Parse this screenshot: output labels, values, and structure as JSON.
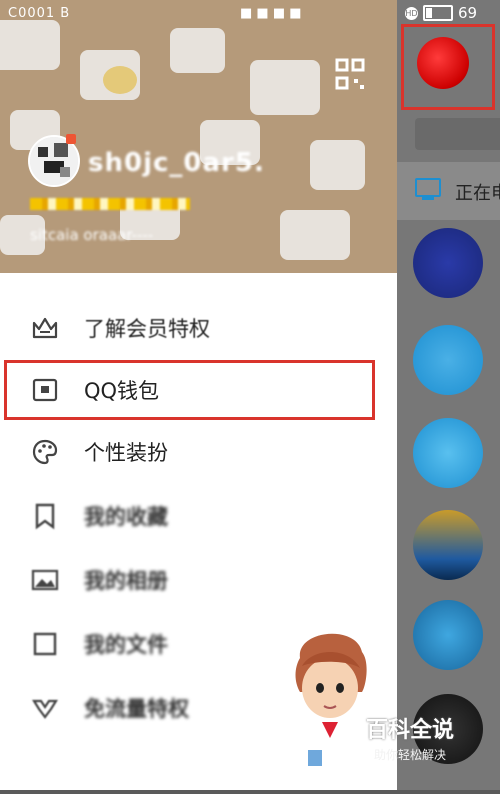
{
  "status_bar": {
    "left_text": "C0001 B",
    "middle_text": "■ ■ ■ ■",
    "battery_level": "69",
    "hd_label": "HD"
  },
  "profile": {
    "nickname": "sh0jc_0ar5.",
    "vip_badges": "",
    "signature": "sitcaia oraaar----"
  },
  "menu": {
    "items": [
      {
        "label": "了解会员特权",
        "icon": "crown-icon",
        "obscured": false
      },
      {
        "label": "QQ钱包",
        "icon": "wallet-icon",
        "obscured": false
      },
      {
        "label": "个性装扮",
        "icon": "palette-icon",
        "obscured": false
      },
      {
        "label": "我的收藏",
        "icon": "bookmark-icon",
        "obscured": true
      },
      {
        "label": "我的相册",
        "icon": "photo-icon",
        "obscured": true
      },
      {
        "label": "我的文件",
        "icon": "folder-icon",
        "obscured": true
      },
      {
        "label": "免流量特权",
        "icon": "gift-icon",
        "obscured": true
      }
    ]
  },
  "right_strip": {
    "online_text": "正在电"
  },
  "watermark": {
    "title": "百科全说",
    "subtitle": "助你轻松解决"
  },
  "colors": {
    "highlight": "#d9342c",
    "accent": "#1d8fd1"
  }
}
